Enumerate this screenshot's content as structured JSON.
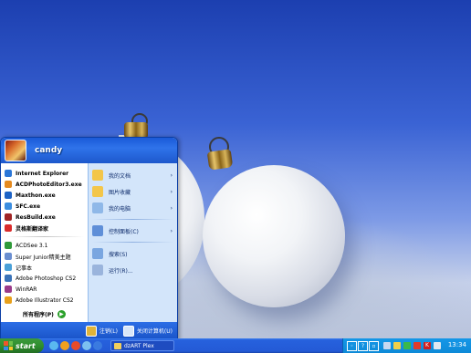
{
  "user": {
    "name": "candy"
  },
  "pinned": [
    {
      "label": "Internet Explorer",
      "icon": "ie-icon",
      "color": "#2a76d8"
    },
    {
      "label": "ACDPhotoEditor3.exe",
      "icon": "acd-editor-icon",
      "color": "#e58a1f"
    },
    {
      "label": "Maxthon.exe",
      "icon": "maxthon-icon",
      "color": "#1d63c6"
    },
    {
      "label": "SFC.exe",
      "icon": "sfc-icon",
      "color": "#3b8de0"
    },
    {
      "label": "ResBuild.exe",
      "icon": "resbuild-icon",
      "color": "#a02424"
    },
    {
      "label": "灵格斯翻译家",
      "icon": "lingoes-icon",
      "color": "#d92b2b"
    }
  ],
  "recent": [
    {
      "label": "ACDSee 3.1",
      "icon": "acdsee-icon",
      "color": "#2f9a3a"
    },
    {
      "label": "Super Junior精美主题",
      "icon": "theme-icon",
      "color": "#6a8ed0"
    },
    {
      "label": "记事本",
      "icon": "notepad-icon",
      "color": "#4aa0d8"
    },
    {
      "label": "Adobe Photoshop CS2",
      "icon": "photoshop-icon",
      "color": "#3a72b8"
    },
    {
      "label": "WinRAR",
      "icon": "winrar-icon",
      "color": "#9a3a8a"
    },
    {
      "label": "Adobe Illustrator CS2",
      "icon": "illustrator-icon",
      "color": "#e8a01a"
    }
  ],
  "all_programs": {
    "label": "所有程序(P)"
  },
  "right_items": [
    {
      "label": "我的文档",
      "icon": "my-documents-icon",
      "color": "#f3c64a",
      "arrow": "›"
    },
    {
      "label": "图片收藏",
      "icon": "my-pictures-icon",
      "color": "#f3c64a",
      "arrow": "›"
    },
    {
      "label": "我的电脑",
      "icon": "my-computer-icon",
      "color": "#8fb8e8",
      "arrow": "›"
    },
    {
      "label": "控制面板(C)",
      "icon": "control-panel-icon",
      "color": "#5f8fd8",
      "arrow": "›"
    },
    {
      "label": "搜索(S)",
      "icon": "search-icon",
      "color": "#7aa6e0",
      "arrow": ""
    },
    {
      "label": "运行(R)...",
      "icon": "run-icon",
      "color": "#9ab4dc",
      "arrow": ""
    }
  ],
  "footer": {
    "logoff": "注销(L)",
    "shutdown": "关闭计算机(U)"
  },
  "taskbar": {
    "start_label": "start",
    "task_label": "dzART Plex",
    "clock": "13:34",
    "tray_question": "?",
    "tray_k": "K"
  },
  "colors": {
    "taskbar": "#245ad6",
    "start_button": "#2f8f2f",
    "tray": "#0e8ad8",
    "menu_header": "#1d58cc",
    "menu_right": "#d3e5fa"
  }
}
